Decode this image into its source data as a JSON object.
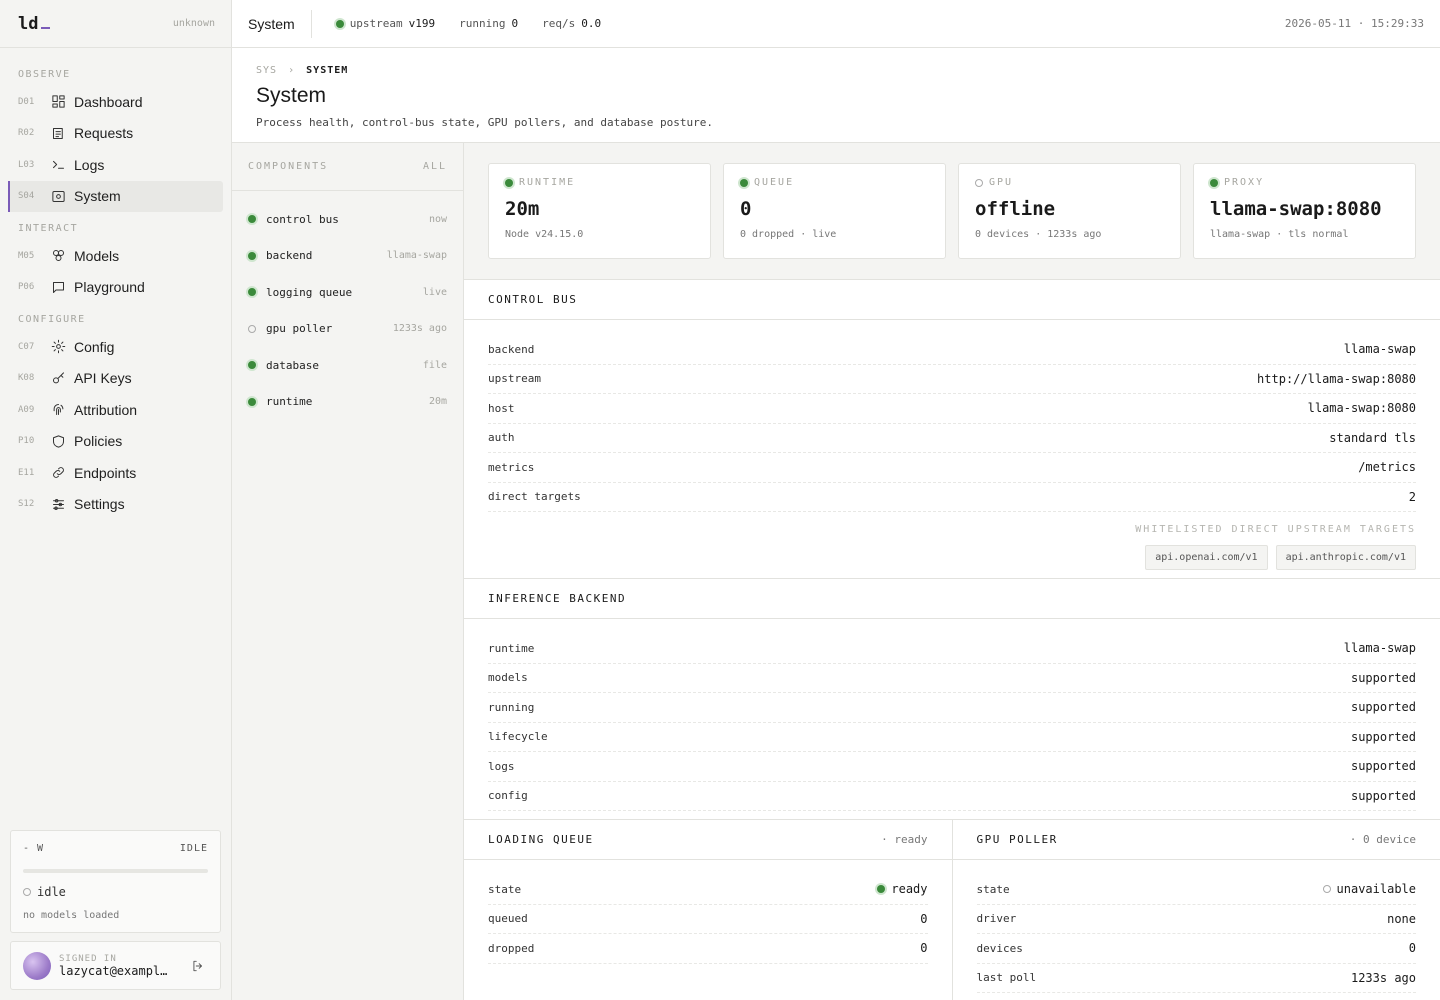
{
  "brand": {
    "logo": "ld",
    "status": "unknown"
  },
  "nav": {
    "sections": [
      {
        "title": "OBSERVE",
        "items": [
          {
            "code": "D01",
            "label": "Dashboard",
            "icon": "dashboard-icon"
          },
          {
            "code": "R02",
            "label": "Requests",
            "icon": "requests-icon"
          },
          {
            "code": "L03",
            "label": "Logs",
            "icon": "terminal-icon"
          },
          {
            "code": "S04",
            "label": "System",
            "icon": "system-icon",
            "active": true
          }
        ]
      },
      {
        "title": "INTERACT",
        "items": [
          {
            "code": "M05",
            "label": "Models",
            "icon": "models-icon"
          },
          {
            "code": "P06",
            "label": "Playground",
            "icon": "chat-icon"
          }
        ]
      },
      {
        "title": "CONFIGURE",
        "items": [
          {
            "code": "C07",
            "label": "Config",
            "icon": "gear-icon"
          },
          {
            "code": "K08",
            "label": "API Keys",
            "icon": "key-icon"
          },
          {
            "code": "A09",
            "label": "Attribution",
            "icon": "fingerprint-icon"
          },
          {
            "code": "P10",
            "label": "Policies",
            "icon": "shield-icon"
          },
          {
            "code": "E11",
            "label": "Endpoints",
            "icon": "link-icon"
          },
          {
            "code": "S12",
            "label": "Settings",
            "icon": "sliders-icon"
          }
        ]
      }
    ]
  },
  "load": {
    "power": "- W",
    "mode": "IDLE",
    "progress": 0,
    "state": "idle",
    "sub": "no models loaded"
  },
  "user": {
    "label": "SIGNED IN",
    "email": "lazycat@example.com"
  },
  "topbar": {
    "title": "System",
    "upstream_label": "upstream",
    "upstream_value": "v199",
    "running_label": "running",
    "running_value": "0",
    "reqs_label": "req/s",
    "reqs_value": "0.0",
    "time": "2026-05-11 · 15:29:33"
  },
  "page": {
    "crumb_root": "SYS",
    "crumb_sep": "›",
    "crumb_current": "SYSTEM",
    "title": "System",
    "description": "Process health, control-bus state, GPU pollers, and database posture."
  },
  "components": {
    "title": "COMPONENTS",
    "filter": "ALL",
    "items": [
      {
        "name": "control bus",
        "meta": "now",
        "ok": true
      },
      {
        "name": "backend",
        "meta": "llama-swap",
        "ok": true
      },
      {
        "name": "logging queue",
        "meta": "live",
        "ok": true
      },
      {
        "name": "gpu poller",
        "meta": "1233s ago",
        "ok": false
      },
      {
        "name": "database",
        "meta": "file",
        "ok": true
      },
      {
        "name": "runtime",
        "meta": "20m",
        "ok": true
      }
    ]
  },
  "stats": [
    {
      "label": "RUNTIME",
      "value": "20m",
      "sub": "Node v24.15.0",
      "ok": true
    },
    {
      "label": "QUEUE",
      "value": "0",
      "sub": "0 dropped · live",
      "ok": true
    },
    {
      "label": "GPU",
      "value": "offline",
      "sub": "0 devices · 1233s ago",
      "ok": false
    },
    {
      "label": "PROXY",
      "value": "llama-swap:8080",
      "sub": "llama-swap · tls normal",
      "ok": true
    }
  ],
  "control_bus": {
    "title": "CONTROL BUS",
    "rows": [
      {
        "key": "backend",
        "value": "llama-swap"
      },
      {
        "key": "upstream",
        "value": "http://llama-swap:8080"
      },
      {
        "key": "host",
        "value": "llama-swap:8080"
      },
      {
        "key": "auth",
        "value": "standard tls"
      },
      {
        "key": "metrics",
        "value": "/metrics"
      },
      {
        "key": "direct targets",
        "value": "2"
      }
    ],
    "whitelist_label": "WHITELISTED DIRECT UPSTREAM TARGETS",
    "whitelist": [
      "api.openai.com/v1",
      "api.anthropic.com/v1"
    ]
  },
  "inference": {
    "title": "INFERENCE BACKEND",
    "rows": [
      {
        "key": "runtime",
        "value": "llama-swap"
      },
      {
        "key": "models",
        "value": "supported"
      },
      {
        "key": "running",
        "value": "supported"
      },
      {
        "key": "lifecycle",
        "value": "supported"
      },
      {
        "key": "logs",
        "value": "supported"
      },
      {
        "key": "config",
        "value": "supported"
      }
    ]
  },
  "loading_queue": {
    "title": "LOADING QUEUE",
    "meta": "· ready",
    "rows": [
      {
        "key": "state",
        "value": "ready",
        "dot": "ok"
      },
      {
        "key": "queued",
        "value": "0"
      },
      {
        "key": "dropped",
        "value": "0"
      }
    ]
  },
  "gpu_poller": {
    "title": "GPU POLLER",
    "meta": "· 0 device",
    "rows": [
      {
        "key": "state",
        "value": "unavailable",
        "dot": "off"
      },
      {
        "key": "driver",
        "value": "none"
      },
      {
        "key": "devices",
        "value": "0"
      },
      {
        "key": "last poll",
        "value": "1233s ago"
      }
    ]
  },
  "colors": {
    "accent": "#7a5bb8",
    "ok": "#3b8a3b"
  }
}
